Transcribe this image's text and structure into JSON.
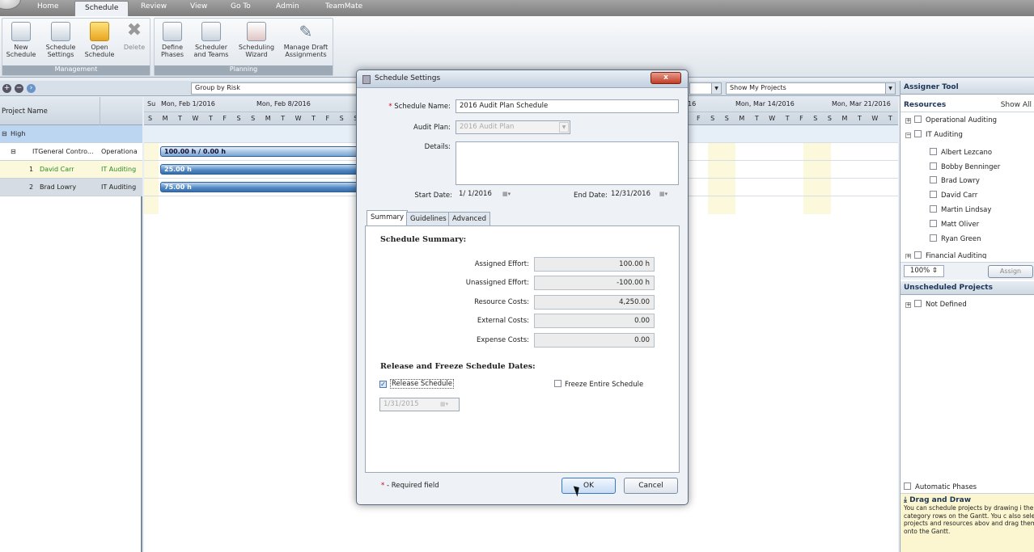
{
  "menu_tabs": [
    "Home",
    "Schedule",
    "Review",
    "View",
    "Go To",
    "Admin",
    "TeamMate"
  ],
  "ribbon": {
    "management": {
      "label": "Management",
      "buttons": [
        {
          "line1": "New",
          "line2": "Schedule",
          "icon": "new-schedule-icon"
        },
        {
          "line1": "Schedule",
          "line2": "Settings",
          "icon": "schedule-settings-icon"
        },
        {
          "line1": "Open",
          "line2": "Schedule",
          "icon": "open-folder-icon"
        },
        {
          "line1": "Delete",
          "line2": "",
          "icon": "delete-icon"
        }
      ]
    },
    "planning": {
      "label": "Planning",
      "buttons": [
        {
          "line1": "Define",
          "line2": "Phases",
          "icon": "define-phases-icon"
        },
        {
          "line1": "Scheduler",
          "line2": "and Teams",
          "icon": "scheduler-teams-icon"
        },
        {
          "line1": "Scheduling",
          "line2": "Wizard",
          "icon": "wizard-icon"
        },
        {
          "line1": "Manage Draft",
          "line2": "Assignments",
          "icon": "pen-icon"
        }
      ]
    }
  },
  "toolbar": {
    "group_by": "Group by Risk",
    "show_projects": "Show My Projects"
  },
  "grid": {
    "col_project": "Project Name",
    "rows": [
      {
        "name": "High",
        "category": ""
      },
      {
        "name": "ITGeneral Contro...",
        "category": "Operationa"
      },
      {
        "name": "David Carr",
        "category": "IT Auditing",
        "index": "1"
      },
      {
        "name": "Brad Lowry",
        "category": "IT Auditing",
        "index": "2"
      }
    ]
  },
  "gantt": {
    "su": "Su",
    "weeks": [
      "Mon, Feb 1/2016",
      "Mon, Feb 8/2016",
      "16",
      "Mon, Mar 14/2016",
      "Mon, Mar 21/2016"
    ],
    "days_left": "S M T W T F S S M T W T F S S",
    "days_right": "F S S M T W T F S S M T W T F",
    "bars": [
      "100.00 h / 0.00 h",
      "25.00 h",
      "75.00 h"
    ]
  },
  "assigner": {
    "title": "Assigner Tool",
    "resources_label": "Resources",
    "show_all": "Show All",
    "tree": [
      "Operational Auditing",
      "IT Auditing",
      "Albert Lezcano",
      "Bobby Benninger",
      "Brad Lowry",
      "David Carr",
      "Martin Lindsay",
      "Matt Oliver",
      "Ryan Green",
      "Financial Auditing"
    ],
    "percent": "100%",
    "assign": "Assign",
    "unscheduled_title": "Unscheduled Projects",
    "unscheduled_item": "Not Defined",
    "automatic_phases": "Automatic Phases",
    "drag_title": "Drag and Draw",
    "drag_text": "You can schedule projects by drawing i the category rows on the Gantt. You c also select projects and resources abov and drag them onto the Gantt."
  },
  "dialog": {
    "title": "Schedule Settings",
    "close": "x",
    "schedule_name_label": "Schedule Name:",
    "schedule_name": "2016 Audit Plan Schedule",
    "audit_plan_label": "Audit Plan:",
    "audit_plan": "2016 Audit Plan",
    "details_label": "Details:",
    "details": "",
    "start_label": "Start Date:",
    "start": "1/ 1/2016",
    "end_label": "End Date:",
    "end": "12/31/2016",
    "tabs": [
      "Summary",
      "Guidelines",
      "Advanced"
    ],
    "summary_head": "Schedule Summary:",
    "summary": [
      {
        "label": "Assigned Effort:",
        "value": "100.00 h"
      },
      {
        "label": "Unassigned Effort:",
        "value": "-100.00 h"
      },
      {
        "label": "Resource Costs:",
        "value": "4,250.00"
      },
      {
        "label": "External Costs:",
        "value": "0.00"
      },
      {
        "label": "Expense Costs:",
        "value": "0.00"
      }
    ],
    "release_head": "Release and Freeze Schedule Dates:",
    "release_label": "Release Schedule",
    "release_checked": true,
    "freeze_label": "Freeze Entire Schedule",
    "release_date": "1/31/2015",
    "required_star": "*",
    "required_text": " - Required field",
    "ok": "OK",
    "cancel": "Cancel"
  },
  "colors": {
    "accent": "#4f86c2",
    "required": "#d0021b",
    "close_button": "#c13d26"
  }
}
